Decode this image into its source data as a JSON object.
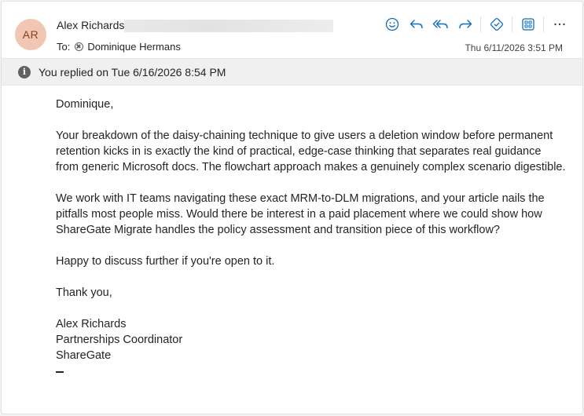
{
  "header": {
    "avatar_initials": "AR",
    "sender_name": "Alex Richards",
    "to_label": "To:",
    "recipient": "Dominique Hermans",
    "date": "Thu 6/11/2026 3:51 PM"
  },
  "toolbar": {
    "icons": [
      "emoji-icon",
      "reply-icon",
      "reply-all-icon",
      "forward-icon",
      "tag-icon",
      "apps-icon",
      "more-icon"
    ]
  },
  "info_bar": {
    "text": "You replied on Tue 6/16/2026 8:54 PM"
  },
  "body": {
    "greeting": "Dominique,",
    "paragraph1": "Your breakdown of the daisy-chaining technique to give users a deletion window before permanent retention kicks in is exactly the kind of practical, edge-case thinking that separates real guidance from generic Microsoft docs. The flowchart approach makes a genuinely complex scenario digestible.",
    "paragraph2": "We work with IT teams navigating these exact MRM-to-DLM migrations, and your article nails the pitfalls most people miss. Would there be interest in a paid placement where we could show how ShareGate Migrate handles the policy assessment and transition piece of this workflow?",
    "paragraph3": "Happy to discuss further if you're open to it.",
    "closing": "Thank you,",
    "sig_name": "Alex Richards",
    "sig_title": "Partnerships Coordinator",
    "sig_company": "ShareGate"
  },
  "colors": {
    "accent": "#0f6cbd",
    "avatar_bg": "#f1c7b3",
    "avatar_text": "#8a3f1e"
  }
}
